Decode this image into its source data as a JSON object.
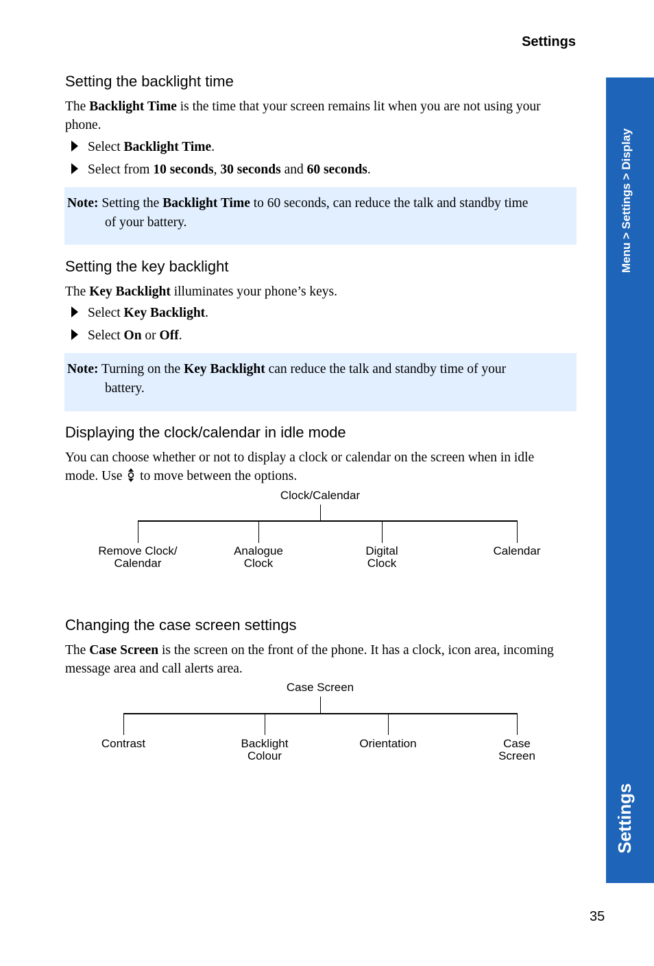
{
  "running_head": "Settings",
  "side_tab": {
    "breadcrumb": "Menu > Settings > Display",
    "section": "Settings",
    "color": "#1e64b8"
  },
  "page_number": "35",
  "note_bg": "#e2efff",
  "sections": {
    "backlight_time": {
      "heading": "Setting the backlight time",
      "intro": {
        "pre": "The ",
        "bold": "Backlight Time",
        "post": " is the time that your screen remains lit when you are not using your phone."
      },
      "steps": [
        {
          "pre": "Select ",
          "b1": "Backlight Time",
          "post": "."
        },
        {
          "pre": "Select from ",
          "b1": "10 seconds",
          "m1": ", ",
          "b2": "30 seconds",
          "m2": " and ",
          "b3": "60 seconds",
          "post": "."
        }
      ],
      "note": {
        "label": "Note:",
        "pre": " Setting the ",
        "bold": "Backlight Time",
        "post1": " to 60 seconds, can reduce the talk and standby time",
        "post2": "of your battery."
      }
    },
    "key_backlight": {
      "heading": "Setting the key backlight",
      "intro": {
        "pre": "The ",
        "bold": "Key Backlight",
        "post": " illuminates your phone’s keys."
      },
      "steps": [
        {
          "pre": "Select ",
          "b1": "Key Backlight",
          "post": "."
        },
        {
          "pre": "Select ",
          "b1": "On",
          "m1": " or ",
          "b2": "Off",
          "post": "."
        }
      ],
      "note": {
        "label": "Note:",
        "pre": " Turning on the ",
        "bold": "Key Backlight",
        "post1": " can reduce the talk and standby time of your",
        "post2": "battery."
      }
    },
    "clock_calendar": {
      "heading": "Displaying the clock/calendar in idle mode",
      "line1": "You can choose whether or not to display a clock or calendar on the screen when in idle",
      "line2_pre": "mode. Use ",
      "line2_post": " to move between the options.",
      "icon": "up-down-navigation-key-icon",
      "tree": {
        "root": "Clock/Calendar",
        "children": [
          {
            "l1": "Remove Clock/",
            "l2": "Calendar"
          },
          {
            "l1": "Analogue",
            "l2": "Clock"
          },
          {
            "l1": "Digital",
            "l2": "Clock"
          },
          {
            "l1": "Calendar",
            "l2": ""
          }
        ]
      }
    },
    "case_screen": {
      "heading": "Changing the case screen settings",
      "intro": {
        "pre": "The ",
        "bold": "Case Screen",
        "post": " is the screen on the front of the phone. It has a clock, icon area, incoming message area and call alerts area."
      },
      "tree": {
        "root": "Case Screen",
        "children": [
          {
            "l1": "Contrast",
            "l2": ""
          },
          {
            "l1": "Backlight",
            "l2": "Colour"
          },
          {
            "l1": "Orientation",
            "l2": ""
          },
          {
            "l1": "Case",
            "l2": "Screen"
          }
        ]
      }
    }
  }
}
